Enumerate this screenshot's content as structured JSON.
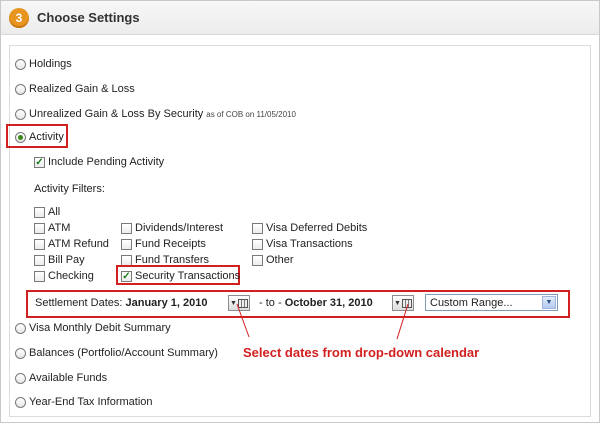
{
  "header": {
    "step_number": "3",
    "title": "Choose Settings"
  },
  "report_options": {
    "holdings": "Holdings",
    "realized": "Realized Gain & Loss",
    "unrealized": "Unrealized Gain & Loss By Security",
    "unrealized_note": "as of COB on 11/05/2010",
    "activity": "Activity",
    "visa_monthly": "Visa Monthly Debit Summary",
    "balances": "Balances (Portfolio/Account Summary)",
    "available_funds": "Available Funds",
    "year_end": "Year-End Tax Information"
  },
  "activity": {
    "include_pending": "Include Pending Activity",
    "filters_label": "Activity Filters:",
    "filters": {
      "all": "All",
      "atm": "ATM",
      "atm_refund": "ATM Refund",
      "bill_pay": "Bill Pay",
      "checking": "Checking",
      "dividends": "Dividends/Interest",
      "fund_receipts": "Fund Receipts",
      "fund_transfers": "Fund Transfers",
      "security_transactions": "Security Transactions",
      "visa_deferred": "Visa Deferred Debits",
      "visa_transactions": "Visa Transactions",
      "other": "Other"
    }
  },
  "settlement": {
    "label": "Settlement Dates:",
    "from": "January 1, 2010",
    "to_sep": "- to -",
    "to": "October 31, 2010",
    "range": "Custom Range..."
  },
  "annotation": "Select dates from drop-down calendar",
  "colors": {
    "highlight": "#d21f1f",
    "step_badge": "#e8951f"
  }
}
